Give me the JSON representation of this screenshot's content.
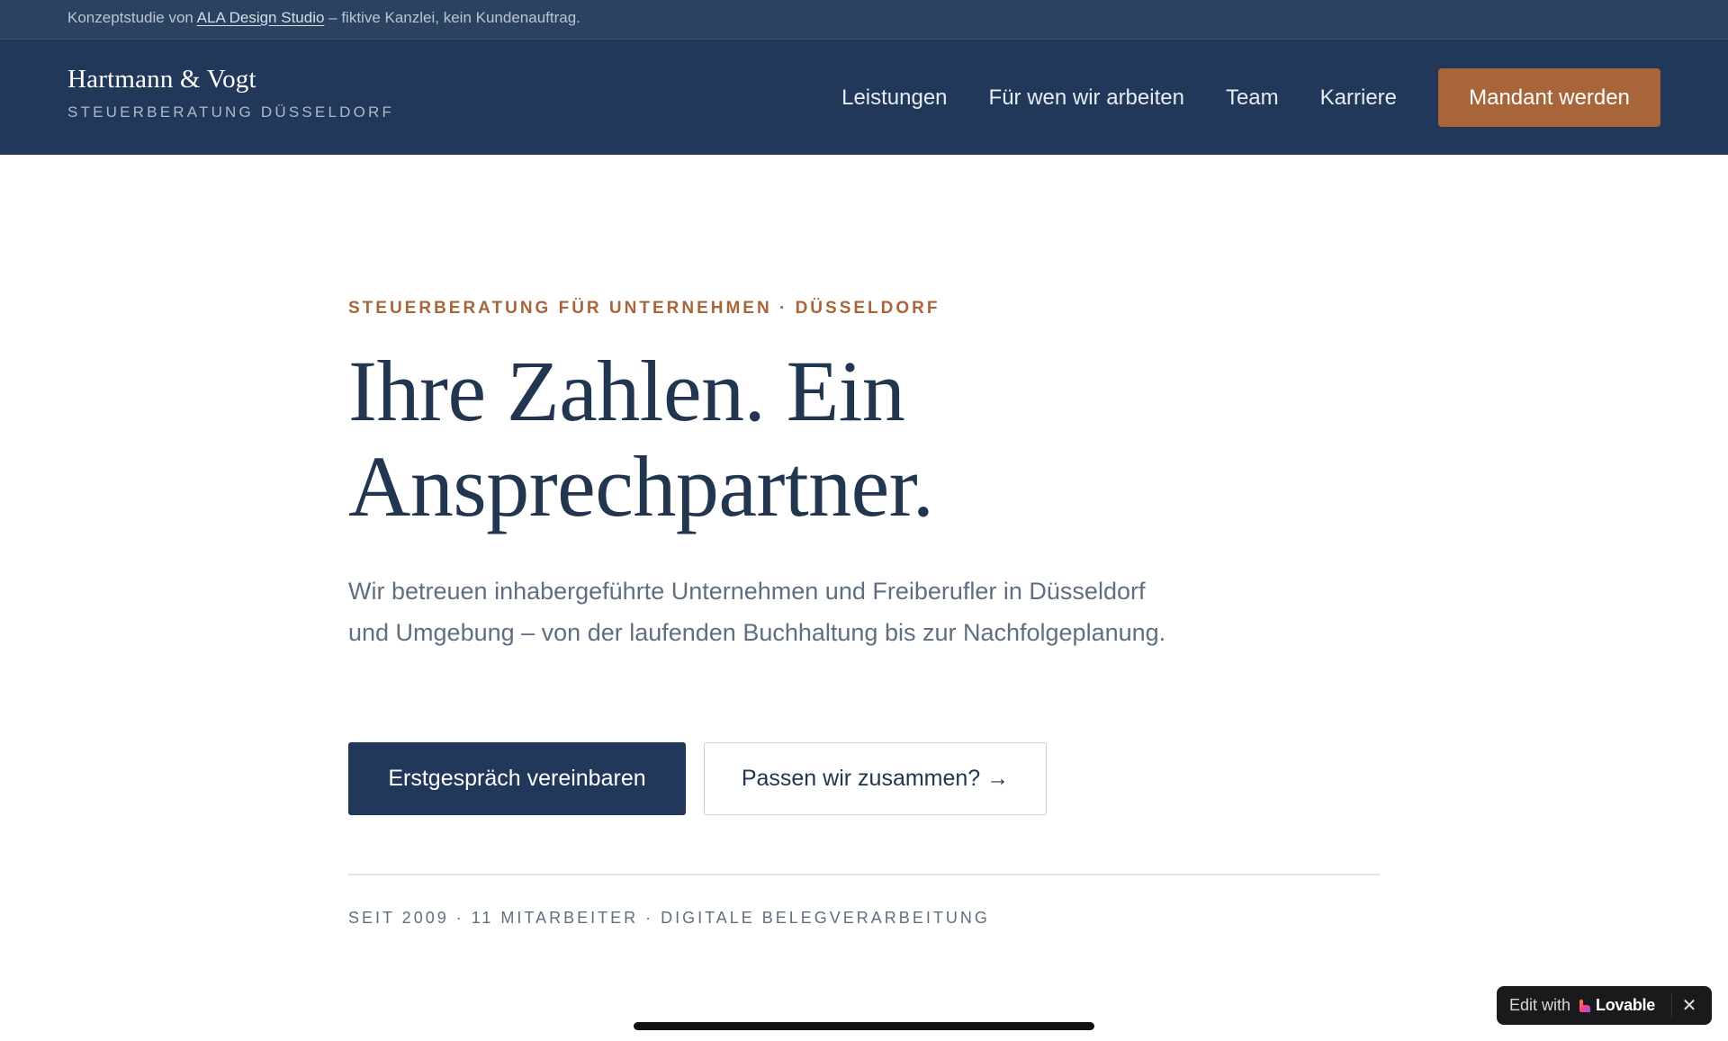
{
  "notice": {
    "prefix": "Konzeptstudie von ",
    "link_text": "ALA Design Studio",
    "suffix": " – fiktive Kanzlei, kein Kundenauftrag."
  },
  "header": {
    "brand_name": "Hartmann & Vogt",
    "brand_tagline": "STEUERBERATUNG DÜSSELDORF",
    "nav": [
      {
        "label": "Leistungen"
      },
      {
        "label": "Für wen wir arbeiten"
      },
      {
        "label": "Team"
      },
      {
        "label": "Karriere"
      }
    ],
    "cta_label": "Mandant werden"
  },
  "hero": {
    "eyebrow": "STEUERBERATUNG FÜR UNTERNEHMEN · DÜSSELDORF",
    "title": "Ihre Zahlen. Ein Ansprechpartner.",
    "lead": "Wir betreuen inhabergeführte Unternehmen und Freiberufler in Düsseldorf und Umgebung – von der laufenden Buchhaltung bis zur Nachfolgeplanung.",
    "primary_button": "Erstgespräch vereinbaren",
    "secondary_button": "Passen wir zusammen? →",
    "facts": "SEIT 2009 · 11 MITARBEITER · DIGITALE BELEGVERARBEITUNG"
  },
  "badge": {
    "edit_text": "Edit with",
    "logo_text": "Lovable",
    "close_symbol": "✕"
  },
  "colors": {
    "navy": "#22385a",
    "accent_copper": "#a9653a",
    "text_muted": "#5f6e80"
  }
}
